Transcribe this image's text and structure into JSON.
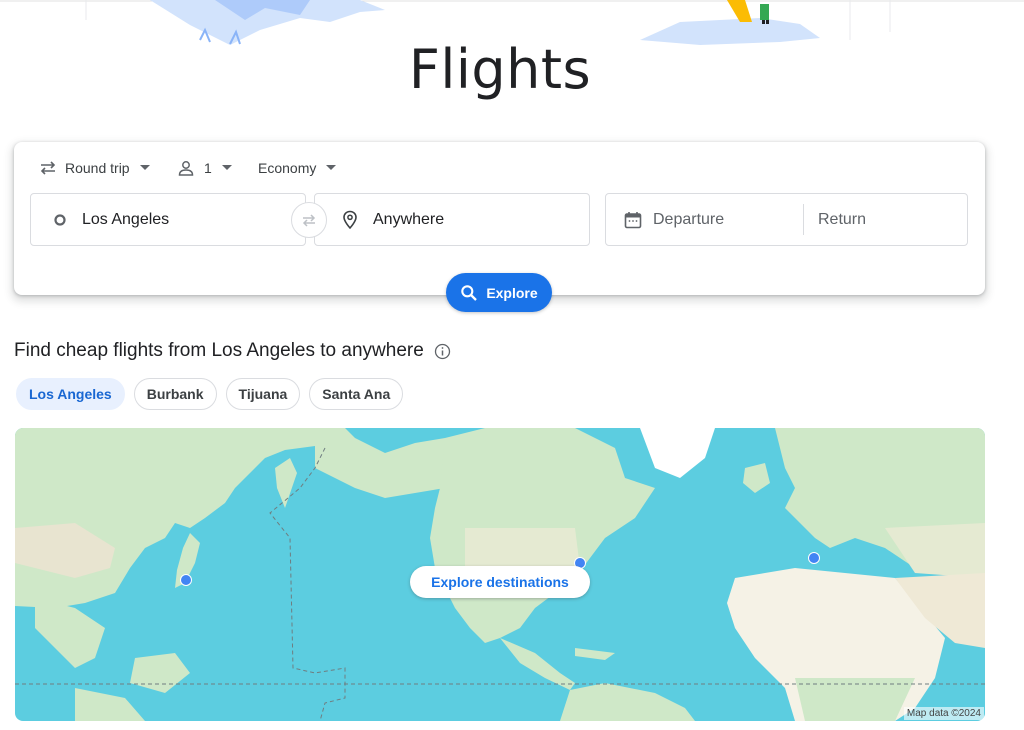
{
  "page": {
    "title": "Flights"
  },
  "search": {
    "trip_type": "Round trip",
    "passengers": "1",
    "cabin_class": "Economy",
    "origin": "Los Angeles",
    "destination": "Anywhere",
    "departure_placeholder": "Departure",
    "return_placeholder": "Return",
    "explore_label": "Explore"
  },
  "section": {
    "title": "Find cheap flights from Los Angeles to anywhere",
    "airports": [
      "Los Angeles",
      "Burbank",
      "Tijuana",
      "Santa Ana"
    ],
    "selected_airport": "Los Angeles"
  },
  "map": {
    "explore_destinations_label": "Explore destinations",
    "credit": "Map data ©2024"
  },
  "colors": {
    "accent": "#1a73e8",
    "chip_selected_bg": "#e8f0fe",
    "ocean": "#5ccde0",
    "land": "#cfe8c8",
    "pin": "#4285f4"
  }
}
